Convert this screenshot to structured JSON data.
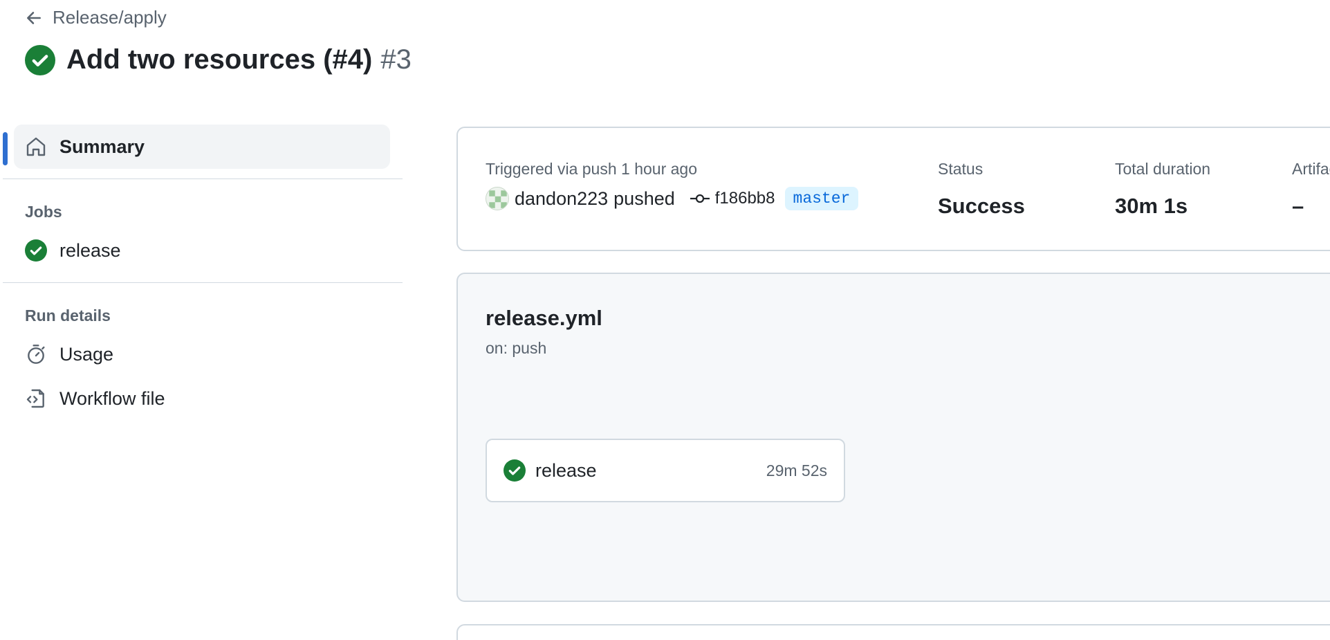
{
  "header": {
    "back_label": "Release/apply",
    "title": "Add two resources (#4)",
    "run_number": "#3"
  },
  "sidebar": {
    "summary_label": "Summary",
    "jobs_heading": "Jobs",
    "jobs": [
      {
        "label": "release",
        "status": "success"
      }
    ],
    "run_details_heading": "Run details",
    "details": [
      {
        "label": "Usage",
        "icon": "stopwatch-icon"
      },
      {
        "label": "Workflow file",
        "icon": "file-code-icon"
      }
    ]
  },
  "summary": {
    "trigger_text": "Triggered via push 1 hour ago",
    "actor": "dandon223",
    "action": "pushed",
    "commit": "f186bb8",
    "branch": "master",
    "status_label": "Status",
    "status_value": "Success",
    "duration_label": "Total duration",
    "duration_value": "30m 1s",
    "artifacts_label": "Artifacts",
    "artifacts_value": "–"
  },
  "workflow": {
    "file_name": "release.yml",
    "trigger": "on: push",
    "jobs": [
      {
        "name": "release",
        "duration": "29m 52s"
      }
    ]
  },
  "colors": {
    "success": "#1a7f37",
    "accent": "#2f6fd0",
    "branch_text": "#0969da",
    "branch_bg": "#ddf4ff"
  }
}
